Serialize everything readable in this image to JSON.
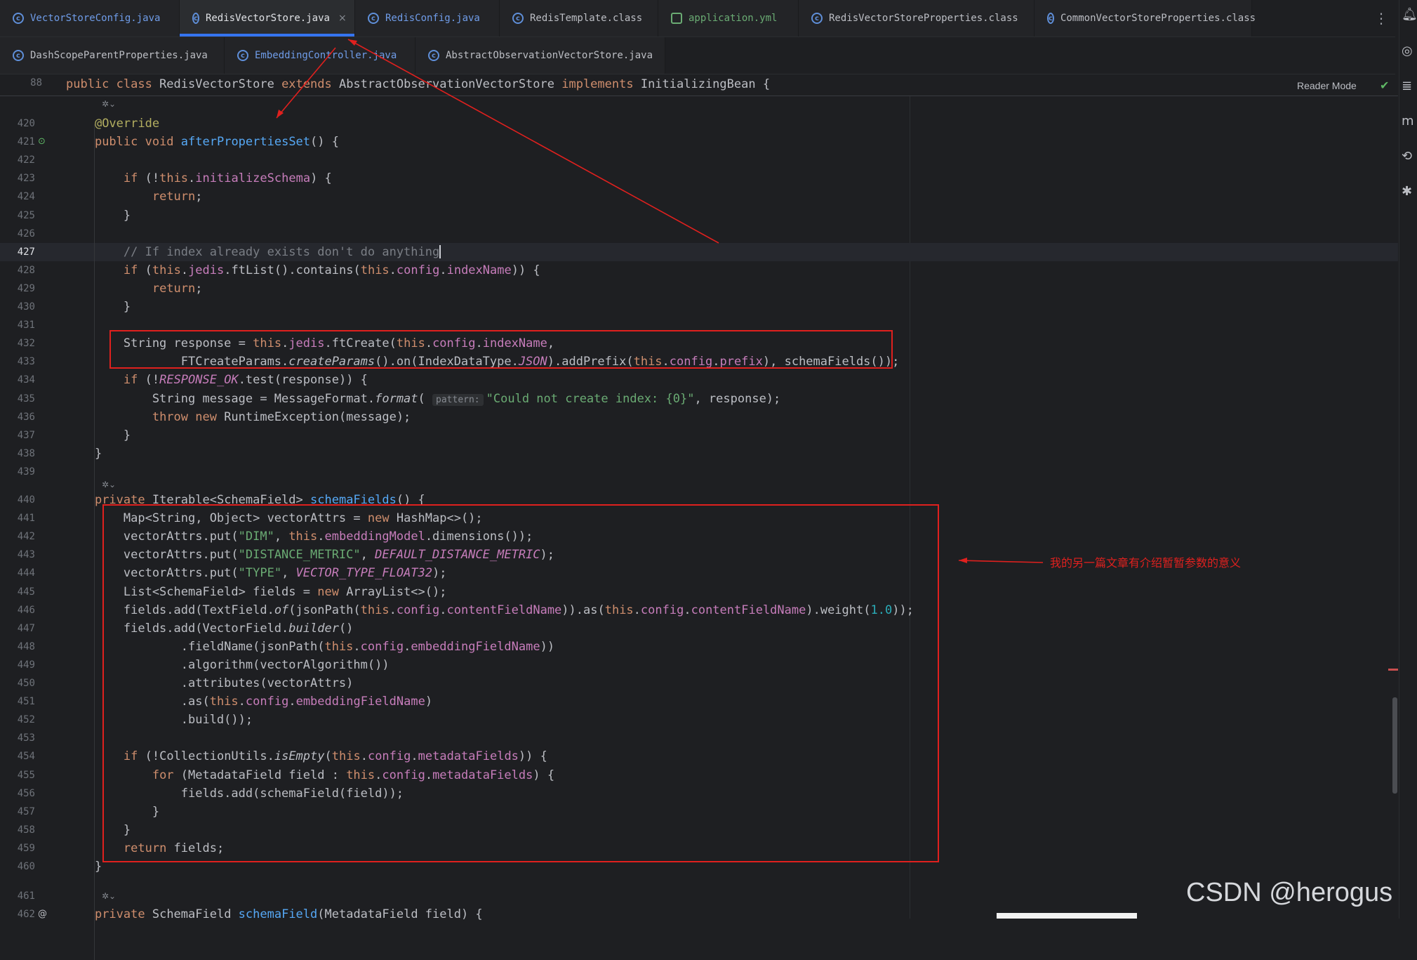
{
  "tabs_row1": [
    {
      "label": "VectorStoreConfig.java",
      "kind": "link",
      "icon": "class-icon"
    },
    {
      "label": "RedisVectorStore.java",
      "kind": "active",
      "icon": "class-icon",
      "close": "×"
    },
    {
      "label": "RedisConfig.java",
      "kind": "link",
      "icon": "class-icon"
    },
    {
      "label": "RedisTemplate.class",
      "kind": "normal",
      "icon": "class-icon"
    },
    {
      "label": "application.yml",
      "kind": "greenlink",
      "icon": "yaml-icon"
    },
    {
      "label": "RedisVectorStoreProperties.class",
      "kind": "normal",
      "icon": "class-icon"
    },
    {
      "label": "CommonVectorStoreProperties.class",
      "kind": "normal",
      "icon": "class-icon"
    }
  ],
  "tabs_row2": [
    {
      "label": "DashScopeParentProperties.java",
      "kind": "normal",
      "icon": "class-icon"
    },
    {
      "label": "EmbeddingController.java",
      "kind": "link",
      "icon": "class-icon"
    },
    {
      "label": "AbstractObservationVectorStore.java",
      "kind": "normal",
      "icon": "class-icon"
    }
  ],
  "sticky": {
    "line": "88",
    "text": "public class RedisVectorStore extends AbstractObservationVectorStore implements InitializingBean {"
  },
  "reader_mode": "Reader Mode",
  "code_lines": [
    {
      "n": "420",
      "html": "    <span class=\"ann\">@Override</span>"
    },
    {
      "n": "421",
      "html": "    <span class=\"kw\">public void</span> <span class=\"fn\">afterPropertiesSet</span>() {"
    },
    {
      "n": "422",
      "html": ""
    },
    {
      "n": "423",
      "html": "        <span class=\"kw\">if</span> (!<span class=\"kw\">this</span>.<span class=\"fld\">initializeSchema</span>) {"
    },
    {
      "n": "424",
      "html": "            <span class=\"kw\">return</span>;"
    },
    {
      "n": "425",
      "html": "        }"
    },
    {
      "n": "426",
      "html": ""
    },
    {
      "n": "427",
      "html": "        <span class=\"com\">// If index already exists don't do anything</span><span class=\"caret\"></span>"
    },
    {
      "n": "428",
      "html": "        <span class=\"kw\">if</span> (<span class=\"kw\">this</span>.<span class=\"fld\">jedis</span>.ftList().contains(<span class=\"kw\">this</span>.<span class=\"fld\">config</span>.<span class=\"fld\">indexName</span>)) {"
    },
    {
      "n": "429",
      "html": "            <span class=\"kw\">return</span>;"
    },
    {
      "n": "430",
      "html": "        }"
    },
    {
      "n": "431",
      "html": ""
    },
    {
      "n": "432",
      "html": "        String response = <span class=\"kw\">this</span>.<span class=\"fld\">jedis</span>.ftCreate(<span class=\"kw\">this</span>.<span class=\"fld\">config</span>.<span class=\"fld\">indexName</span>,"
    },
    {
      "n": "433",
      "html": "                FTCreateParams.<span class=\"ital\">createParams</span>().on(IndexDataType.<span class=\"cst\">JSON</span>).addPrefix(<span class=\"kw\">this</span>.<span class=\"fld\">config</span>.<span class=\"fld\">prefix</span>), schemaFields());"
    },
    {
      "n": "434",
      "html": "        <span class=\"kw\">if</span> (!<span class=\"cst\">RESPONSE_OK</span>.test(response)) {"
    },
    {
      "n": "435",
      "html": "            String message = MessageFormat.<span class=\"ital\">format</span>( <span class=\"hint\">pattern:</span><span class=\"str\">\"Could not create index: {0}\"</span>, response);"
    },
    {
      "n": "436",
      "html": "            <span class=\"kw\">throw new</span> RuntimeException(message);"
    },
    {
      "n": "437",
      "html": "        }"
    },
    {
      "n": "438",
      "html": "    }"
    },
    {
      "n": "439",
      "html": ""
    },
    {
      "n": "440",
      "html": "    <span class=\"kw\">private</span> Iterable&lt;SchemaField&gt; <span class=\"fn\">schemaFields</span>() {"
    },
    {
      "n": "441",
      "html": "        Map&lt;String, Object&gt; vectorAttrs = <span class=\"kw\">new</span> HashMap&lt;&gt;();"
    },
    {
      "n": "442",
      "html": "        vectorAttrs.put(<span class=\"str\">\"DIM\"</span>, <span class=\"kw\">this</span>.<span class=\"fld\">embeddingModel</span>.dimensions());"
    },
    {
      "n": "443",
      "html": "        vectorAttrs.put(<span class=\"str\">\"DISTANCE_METRIC\"</span>, <span class=\"cst\">DEFAULT_DISTANCE_METRIC</span>);"
    },
    {
      "n": "444",
      "html": "        vectorAttrs.put(<span class=\"str\">\"TYPE\"</span>, <span class=\"cst\">VECTOR_TYPE_FLOAT32</span>);"
    },
    {
      "n": "445",
      "html": "        List&lt;SchemaField&gt; fields = <span class=\"kw\">new</span> ArrayList&lt;&gt;();"
    },
    {
      "n": "446",
      "html": "        fields.add(TextField.<span class=\"ital\">of</span>(jsonPath(<span class=\"kw\">this</span>.<span class=\"fld\">config</span>.<span class=\"fld\">contentFieldName</span>)).as(<span class=\"kw\">this</span>.<span class=\"fld\">config</span>.<span class=\"fld\">contentFieldName</span>).weight(<span class=\"num\">1.0</span>));"
    },
    {
      "n": "447",
      "html": "        fields.add(VectorField.<span class=\"ital\">builder</span>()"
    },
    {
      "n": "448",
      "html": "                .fieldName(jsonPath(<span class=\"kw\">this</span>.<span class=\"fld\">config</span>.<span class=\"fld\">embeddingFieldName</span>))"
    },
    {
      "n": "449",
      "html": "                .algorithm(vectorAlgorithm())"
    },
    {
      "n": "450",
      "html": "                .attributes(vectorAttrs)"
    },
    {
      "n": "451",
      "html": "                .as(<span class=\"kw\">this</span>.<span class=\"fld\">config</span>.<span class=\"fld\">embeddingFieldName</span>)"
    },
    {
      "n": "452",
      "html": "                .build());"
    },
    {
      "n": "453",
      "html": ""
    },
    {
      "n": "454",
      "html": "        <span class=\"kw\">if</span> (!CollectionUtils.<span class=\"ital\">isEmpty</span>(<span class=\"kw\">this</span>.<span class=\"fld\">config</span>.<span class=\"fld\">metadataFields</span>)) {"
    },
    {
      "n": "455",
      "html": "            <span class=\"kw\">for</span> (MetadataField field : <span class=\"kw\">this</span>.<span class=\"fld\">config</span>.<span class=\"fld\">metadataFields</span>) {"
    },
    {
      "n": "456",
      "html": "                fields.add(schemaField(field));"
    },
    {
      "n": "457",
      "html": "            }"
    },
    {
      "n": "458",
      "html": "        }"
    },
    {
      "n": "459",
      "html": "        <span class=\"kw\">return</span> fields;"
    },
    {
      "n": "460",
      "html": "    }"
    },
    {
      "n": "461",
      "html": ""
    },
    {
      "n": "462",
      "html": "    <span class=\"kw\">private</span> SchemaField <span class=\"fn\">schemaField</span>(MetadataField field) {"
    }
  ],
  "annotation_note": "我的另一篇文章有介绍暂暂参数的意义",
  "watermark": "CSDN @herogus",
  "more_icon": "⋮",
  "colors": {
    "keyword": "#cf8e6d",
    "function": "#56a8f5",
    "field": "#c77dbb",
    "string": "#6aab73",
    "annotation_red": "#e0201e",
    "tab_accent": "#3574f0"
  }
}
